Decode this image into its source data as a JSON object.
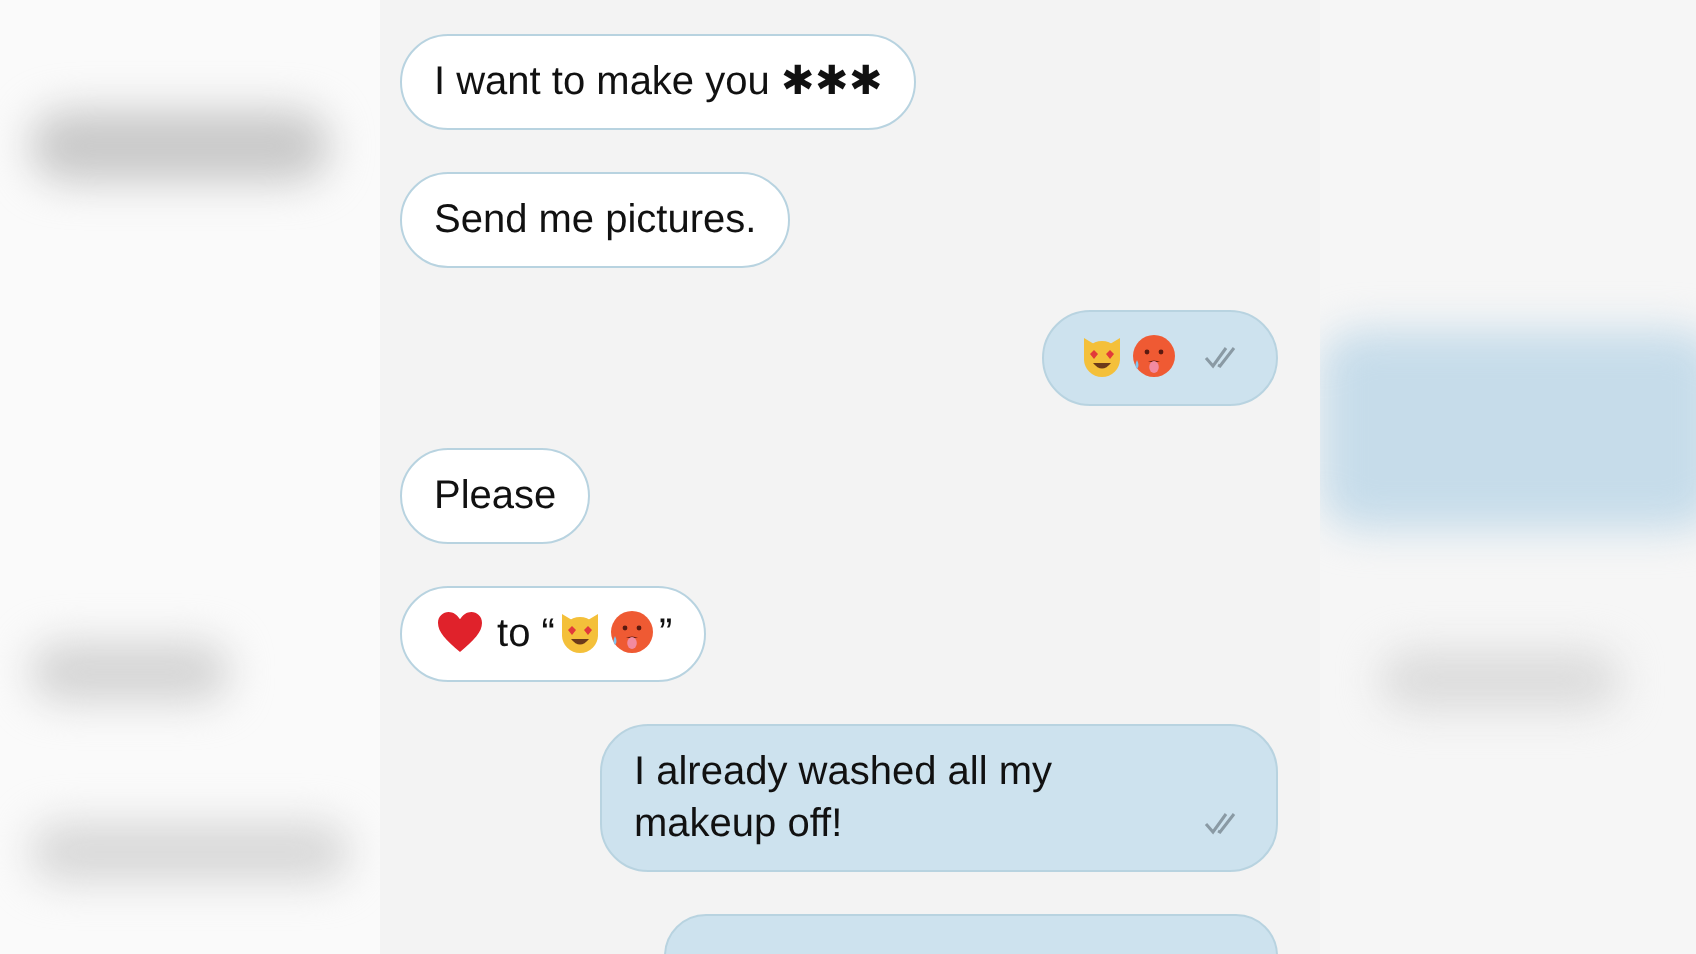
{
  "messages": [
    {
      "outgoing": false,
      "segments": [
        {
          "kind": "text",
          "text": "I want to make you ✱✱✱"
        }
      ]
    },
    {
      "outgoing": false,
      "segments": [
        {
          "kind": "text",
          "text": "Send me pictures."
        }
      ]
    },
    {
      "outgoing": true,
      "read": true,
      "segments": [
        {
          "kind": "cat"
        },
        {
          "kind": "hot"
        }
      ]
    },
    {
      "outgoing": false,
      "segments": [
        {
          "kind": "text",
          "text": "Please"
        }
      ]
    },
    {
      "outgoing": false,
      "segments": [
        {
          "kind": "heart"
        },
        {
          "kind": "text",
          "text": " to “"
        },
        {
          "kind": "cat"
        },
        {
          "kind": "hot"
        },
        {
          "kind": "text",
          "text": "”"
        }
      ]
    },
    {
      "outgoing": true,
      "read": true,
      "segments": [
        {
          "kind": "text",
          "text": "I already washed all my makeup off!"
        }
      ]
    }
  ]
}
